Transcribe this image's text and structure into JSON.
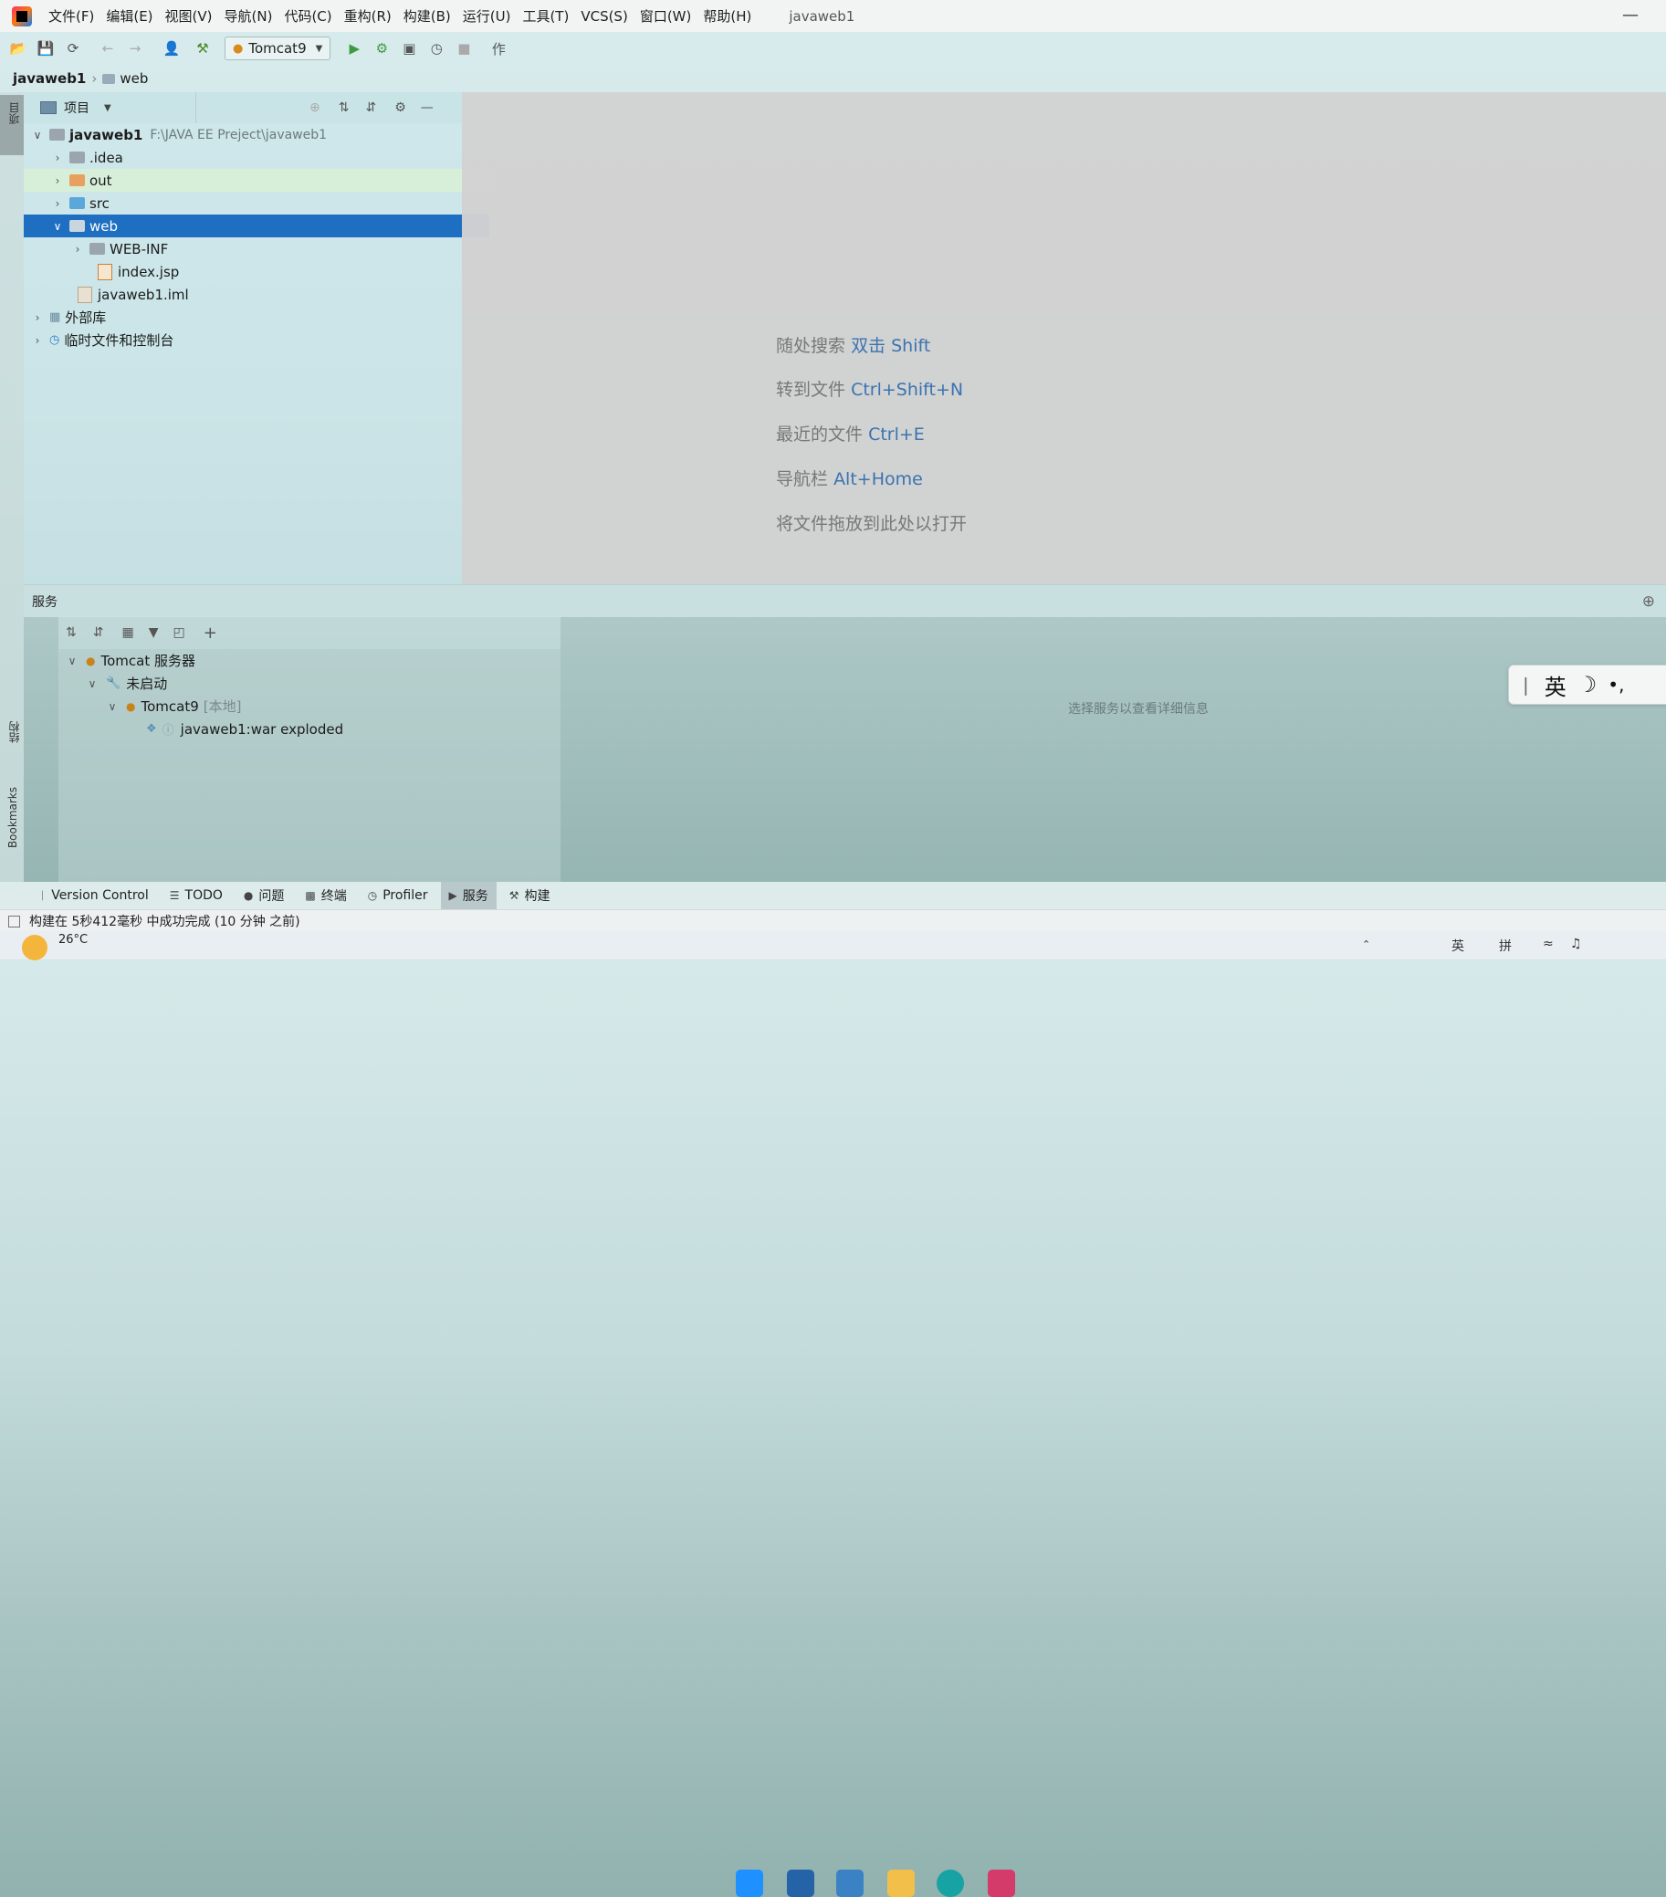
{
  "menubar": {
    "items": [
      "文件(F)",
      "编辑(E)",
      "视图(V)",
      "导航(N)",
      "代码(C)",
      "重构(R)",
      "构建(B)",
      "运行(U)",
      "工具(T)",
      "VCS(S)",
      "窗口(W)",
      "帮助(H)"
    ],
    "window_title": "javaweb1"
  },
  "toolbar": {
    "run_config": "Tomcat9"
  },
  "breadcrumb": {
    "project": "javaweb1",
    "folder": "web"
  },
  "side_strip": {
    "project": "项目",
    "structure": "结构",
    "bookmarks": "Bookmarks"
  },
  "project_panel": {
    "title": "项目",
    "tree": {
      "root": {
        "name": "javaweb1",
        "path": "F:\\JAVA EE Preject\\javaweb1"
      },
      "idea": ".idea",
      "out": "out",
      "src": "src",
      "web": "web",
      "webinf": "WEB-INF",
      "index": "index.jsp",
      "iml": "javaweb1.iml",
      "libs": "外部库",
      "scratches": "临时文件和控制台"
    }
  },
  "editor_hints": [
    {
      "text": "随处搜索",
      "key": "双击 Shift"
    },
    {
      "text": "转到文件",
      "key": "Ctrl+Shift+N"
    },
    {
      "text": "最近的文件",
      "key": "Ctrl+E"
    },
    {
      "text": "导航栏",
      "key": "Alt+Home"
    },
    {
      "text": "将文件拖放到此处以打开",
      "key": ""
    }
  ],
  "services": {
    "title": "服务",
    "tree": {
      "tomcat_server": "Tomcat 服务器",
      "not_started": "未启动",
      "tomcat9": "Tomcat9",
      "tomcat9_tag": "[本地]",
      "artifact": "javaweb1:war exploded"
    },
    "empty_message": "选择服务以查看详细信息"
  },
  "ime": {
    "lang": "英"
  },
  "bottom_tabs": [
    {
      "label": "Version Control",
      "active": false
    },
    {
      "label": "TODO",
      "active": false
    },
    {
      "label": "问题",
      "active": false
    },
    {
      "label": "终端",
      "active": false
    },
    {
      "label": "Profiler",
      "active": false
    },
    {
      "label": "服务",
      "active": true
    },
    {
      "label": "构建",
      "active": false
    }
  ],
  "status": {
    "message": "构建在 5秒412毫秒 中成功完成 (10 分钟 之前)"
  },
  "taskbar": {
    "weather": "26°C",
    "ime_lang": "英",
    "ime_mode": "拼"
  },
  "colors": {
    "selection": "#1e6fc1",
    "hint_key": "#3b73b0"
  }
}
